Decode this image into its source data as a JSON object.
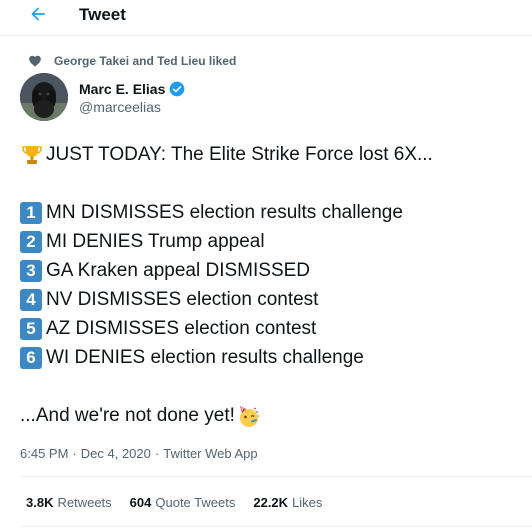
{
  "header": {
    "title": "Tweet",
    "back_icon": "arrow-left-icon",
    "accent_color": "#1d9bf0"
  },
  "social_context": {
    "icon": "heart-icon",
    "text": "George Takei and Ted Lieu liked"
  },
  "author": {
    "name": "Marc E. Elias",
    "handle": "@marceelias",
    "verified": true
  },
  "tweet": {
    "intro": "JUST TODAY: The Elite Strike Force lost 6X...",
    "items": [
      {
        "number": "1",
        "text": "MN DISMISSES election results challenge"
      },
      {
        "number": "2",
        "text": "MI DENIES Trump appeal"
      },
      {
        "number": "3",
        "text": "GA Kraken appeal DISMISSED"
      },
      {
        "number": "4",
        "text": "NV DISMISSES election contest"
      },
      {
        "number": "5",
        "text": "AZ DISMISSES election contest"
      },
      {
        "number": "6",
        "text": "WI DENIES election results challenge"
      }
    ],
    "outro": "...And we're not done yet!",
    "keycap_color": "#3b88c3"
  },
  "meta": {
    "time": "6:45 PM",
    "date": "Dec 4, 2020",
    "separator": "·",
    "source": "Twitter Web App"
  },
  "stats": {
    "retweets_count": "3.8K",
    "retweets_label": "Retweets",
    "quote_count": "604",
    "quote_label": "Quote Tweets",
    "likes_count": "22.2K",
    "likes_label": "Likes"
  }
}
